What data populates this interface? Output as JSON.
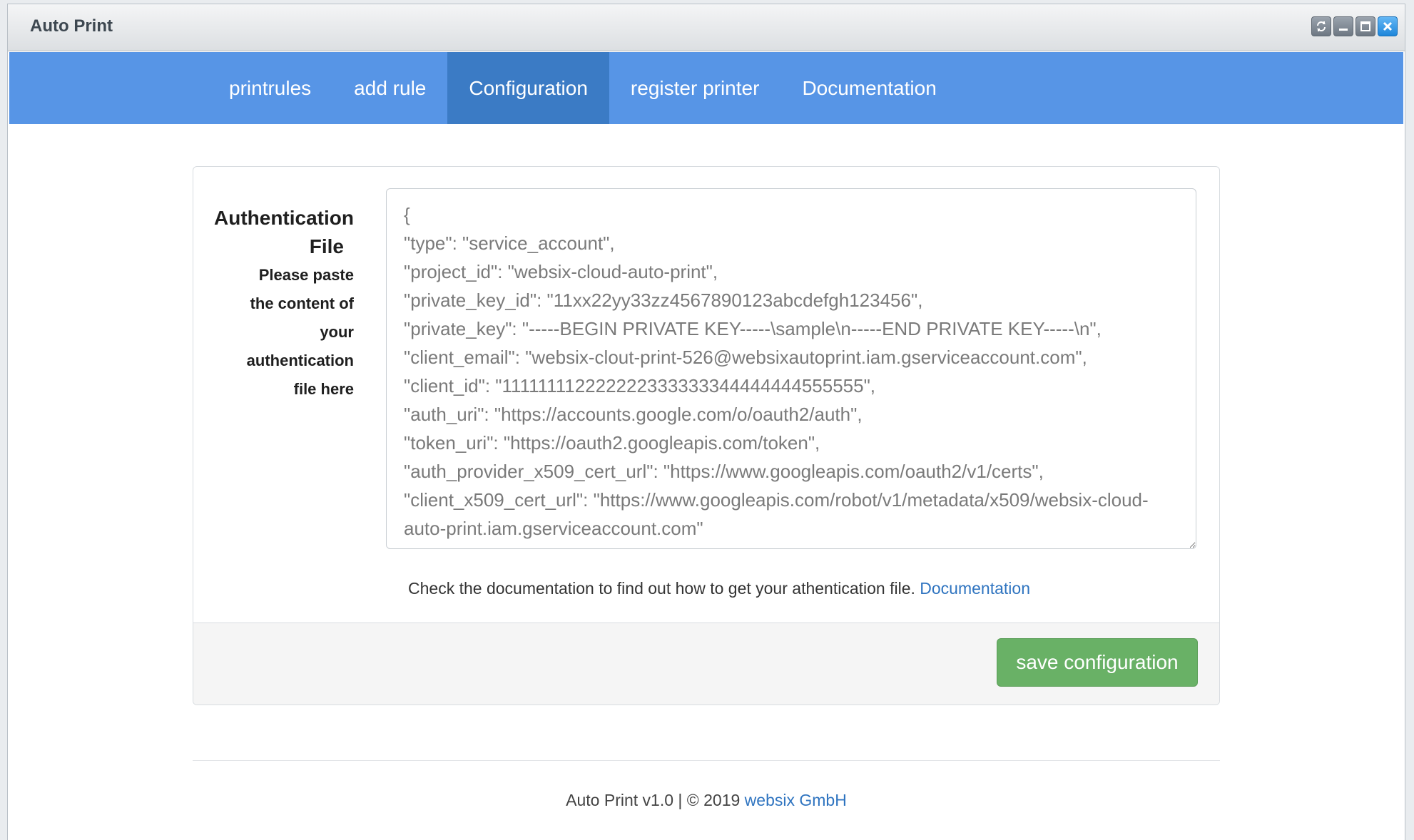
{
  "window": {
    "title": "Auto Print",
    "controls": [
      {
        "name": "refresh-icon"
      },
      {
        "name": "minimize-icon"
      },
      {
        "name": "maximize-icon"
      },
      {
        "name": "close-icon"
      }
    ]
  },
  "nav": {
    "items": [
      {
        "label": "printrules",
        "active": false
      },
      {
        "label": "add rule",
        "active": false
      },
      {
        "label": "Configuration",
        "active": true
      },
      {
        "label": "register printer",
        "active": false
      },
      {
        "label": "Documentation",
        "active": false
      }
    ]
  },
  "form": {
    "label_title_line1": "Authentication",
    "label_title_line2": "File",
    "label_help_lines": [
      "Please paste",
      "the content of",
      "your",
      "authentication",
      "file here"
    ],
    "auth_content": "{\n\"type\": \"service_account\",\n\"project_id\": \"websix-cloud-auto-print\",\n\"private_key_id\": \"11xx22yy33zz4567890123abcdefgh123456\",\n\"private_key\": \"-----BEGIN PRIVATE KEY-----\\sample\\n-----END PRIVATE KEY-----\\n\",\n\"client_email\": \"websix-clout-print-526@websixautoprint.iam.gserviceaccount.com\",\n\"client_id\": \"111111112222222333333344444444555555\",\n\"auth_uri\": \"https://accounts.google.com/o/oauth2/auth\",\n\"token_uri\": \"https://oauth2.googleapis.com/token\",\n\"auth_provider_x509_cert_url\": \"https://www.googleapis.com/oauth2/v1/certs\",\n\"client_x509_cert_url\": \"https://www.googleapis.com/robot/v1/metadata/x509/websix-cloud-auto-print.iam.gserviceaccount.com\"\n}",
    "help_text": "Check the documentation to find out how to get your athentication file.",
    "help_link": "Documentation",
    "save_label": "save configuration"
  },
  "footer": {
    "text": "Auto Print v1.0 | © 2019",
    "company_link": "websix GmbH"
  },
  "colors": {
    "nav_bg": "#5795e6",
    "nav_active": "#3b7bc5",
    "save_button": "#69b166",
    "link": "#2f74c0"
  }
}
